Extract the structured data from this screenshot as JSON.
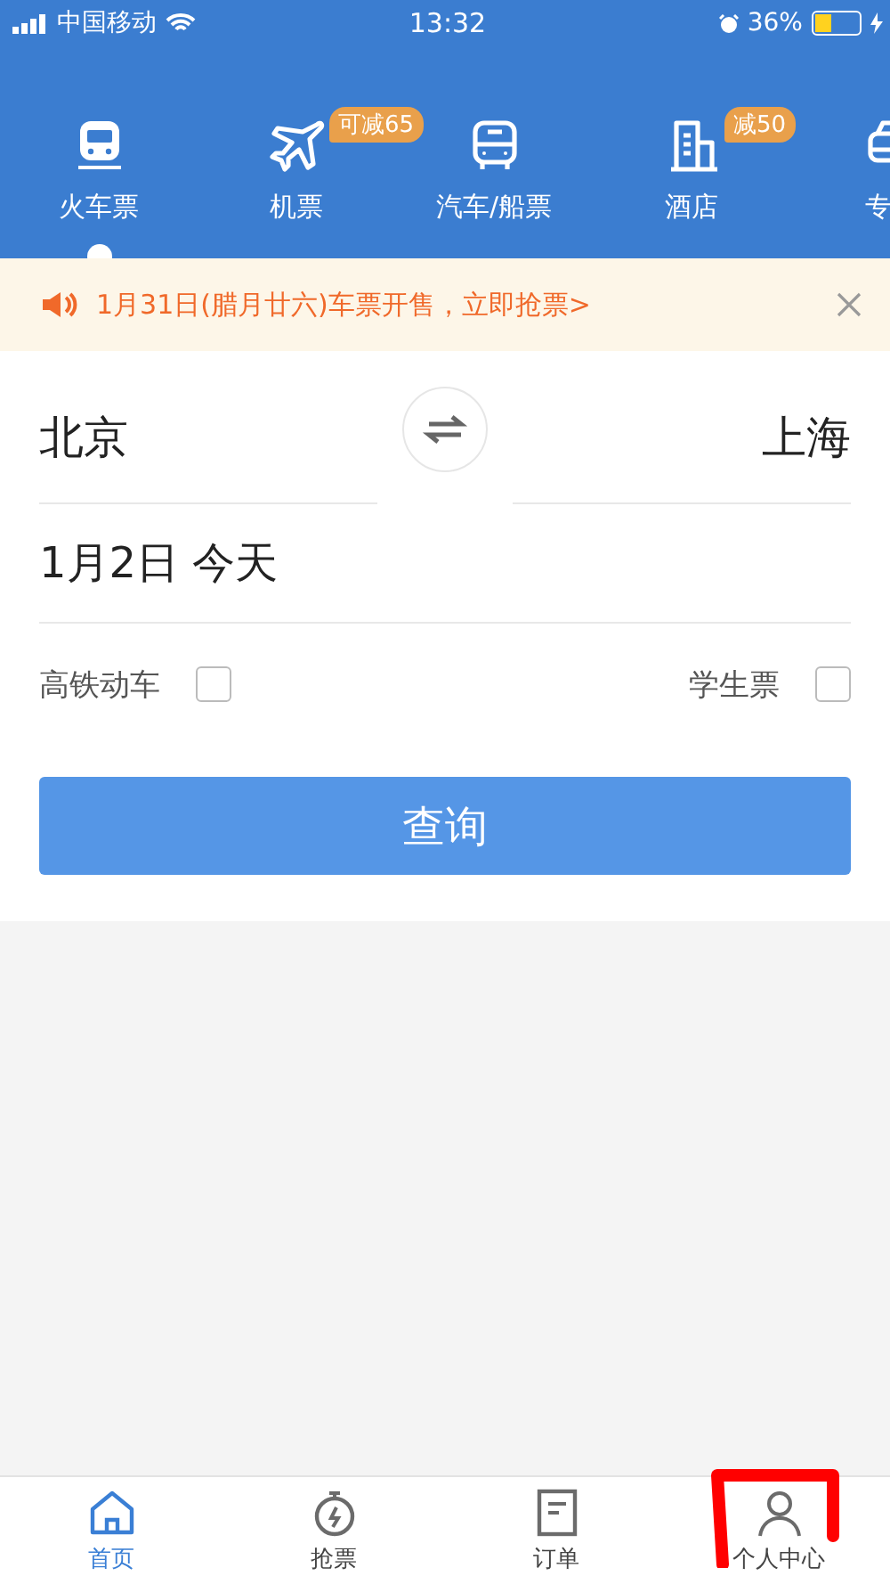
{
  "status_bar": {
    "carrier": "中国移动",
    "time": "13:32",
    "battery": "36%"
  },
  "categories": [
    {
      "kind": "train",
      "label": "火车票",
      "selected": true
    },
    {
      "kind": "plane",
      "label": "机票",
      "selected": false,
      "badge": "可减65"
    },
    {
      "kind": "bus",
      "label": "汽车/船票",
      "selected": false
    },
    {
      "kind": "hotel",
      "label": "酒店",
      "selected": false,
      "badge": "减50"
    },
    {
      "kind": "car",
      "label": "专",
      "selected": false
    }
  ],
  "notice": {
    "text": "1月31日(腊月廿六)车票开售，立即抢票>"
  },
  "route": {
    "from": "北京",
    "to": "上海"
  },
  "date": {
    "day": "1月2日",
    "note": "今天"
  },
  "options": [
    {
      "label": "高铁动车",
      "checked": false
    },
    {
      "label": "学生票",
      "checked": false
    }
  ],
  "search_button": "查询",
  "tab_bar": [
    {
      "kind": "home",
      "label": "首页",
      "selected": true
    },
    {
      "kind": "timer",
      "label": "抢票",
      "selected": false
    },
    {
      "kind": "order",
      "label": "订单",
      "selected": false
    },
    {
      "kind": "person",
      "label": "个人中心",
      "selected": false
    }
  ]
}
